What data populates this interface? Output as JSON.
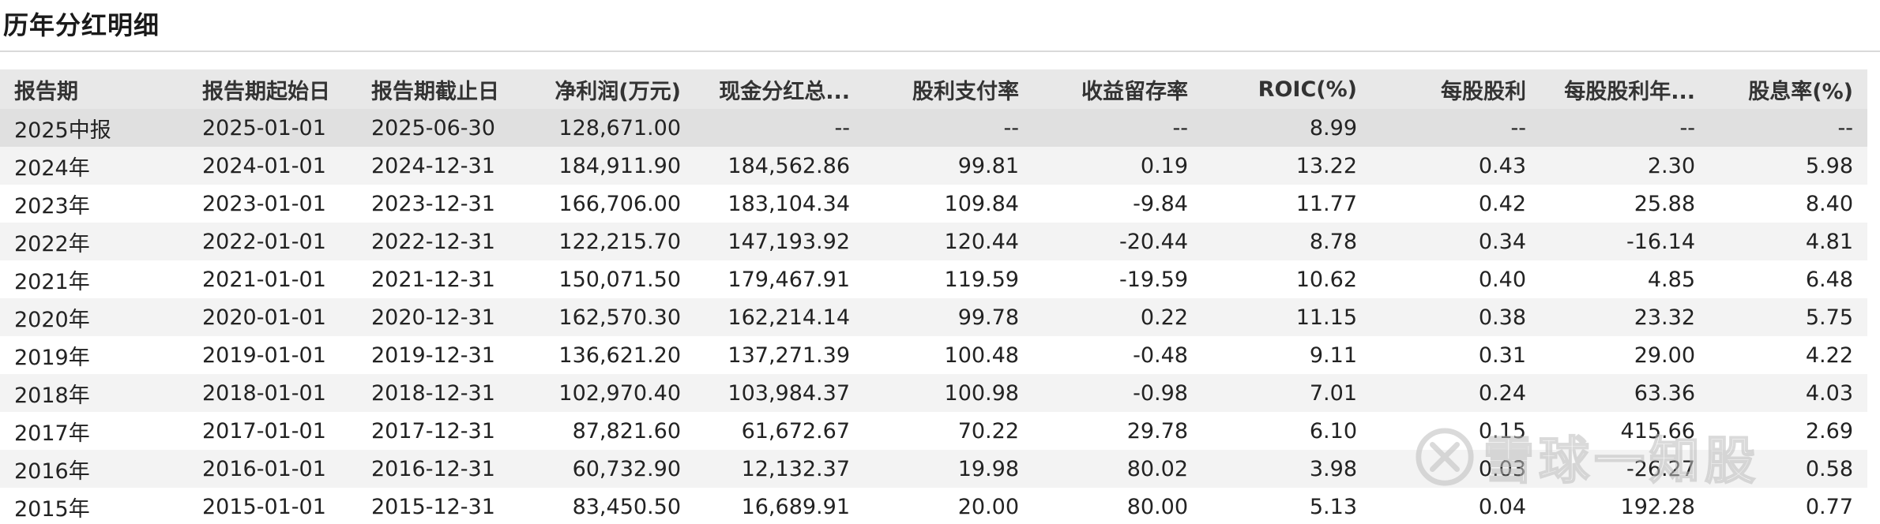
{
  "section": {
    "title": "历年分红明细"
  },
  "table": {
    "headers": [
      "报告期",
      "报告期起始日",
      "报告期截止日",
      "净利润(万元)",
      "现金分红总...",
      "股利支付率",
      "收益留存率",
      "ROIC(%)",
      "每股股利",
      "每股股利年...",
      "股息率(%)"
    ],
    "rows": [
      [
        "2025中报",
        "2025-01-01",
        "2025-06-30",
        "128,671.00",
        "--",
        "--",
        "--",
        "8.99",
        "--",
        "--",
        "--"
      ],
      [
        "2024年",
        "2024-01-01",
        "2024-12-31",
        "184,911.90",
        "184,562.86",
        "99.81",
        "0.19",
        "13.22",
        "0.43",
        "2.30",
        "5.98"
      ],
      [
        "2023年",
        "2023-01-01",
        "2023-12-31",
        "166,706.00",
        "183,104.34",
        "109.84",
        "-9.84",
        "11.77",
        "0.42",
        "25.88",
        "8.40"
      ],
      [
        "2022年",
        "2022-01-01",
        "2022-12-31",
        "122,215.70",
        "147,193.92",
        "120.44",
        "-20.44",
        "8.78",
        "0.34",
        "-16.14",
        "4.81"
      ],
      [
        "2021年",
        "2021-01-01",
        "2021-12-31",
        "150,071.50",
        "179,467.91",
        "119.59",
        "-19.59",
        "10.62",
        "0.40",
        "4.85",
        "6.48"
      ],
      [
        "2020年",
        "2020-01-01",
        "2020-12-31",
        "162,570.30",
        "162,214.14",
        "99.78",
        "0.22",
        "11.15",
        "0.38",
        "23.32",
        "5.75"
      ],
      [
        "2019年",
        "2019-01-01",
        "2019-12-31",
        "136,621.20",
        "137,271.39",
        "100.48",
        "-0.48",
        "9.11",
        "0.31",
        "29.00",
        "4.22"
      ],
      [
        "2018年",
        "2018-01-01",
        "2018-12-31",
        "102,970.40",
        "103,984.37",
        "100.98",
        "-0.98",
        "7.01",
        "0.24",
        "63.36",
        "4.03"
      ],
      [
        "2017年",
        "2017-01-01",
        "2017-12-31",
        "87,821.60",
        "61,672.67",
        "70.22",
        "29.78",
        "6.10",
        "0.15",
        "415.66",
        "2.69"
      ],
      [
        "2016年",
        "2016-01-01",
        "2016-12-31",
        "60,732.90",
        "12,132.37",
        "19.98",
        "80.02",
        "3.98",
        "0.03",
        "-26.27",
        "0.58"
      ],
      [
        "2015年",
        "2015-01-01",
        "2015-12-31",
        "83,450.50",
        "16,689.91",
        "20.00",
        "80.00",
        "5.13",
        "0.04",
        "192.28",
        "0.77"
      ]
    ]
  },
  "watermark": {
    "text": "雪球一知股",
    "icon": "xueqiu-logo-icon"
  }
}
